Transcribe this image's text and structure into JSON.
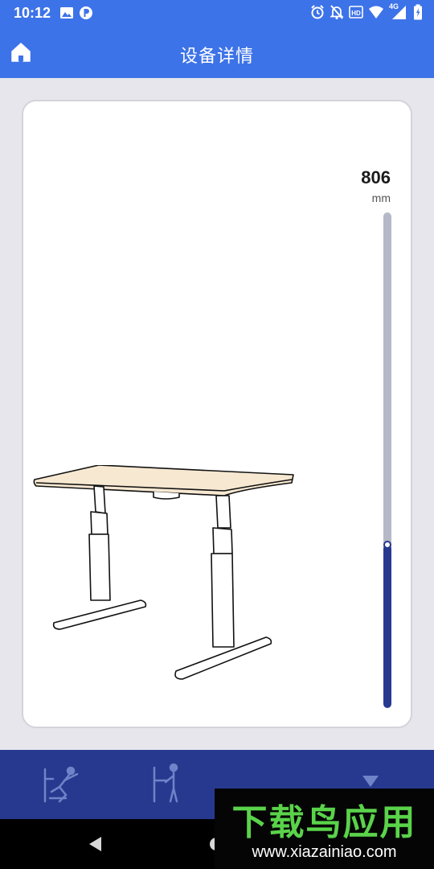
{
  "status_bar": {
    "time": "10:12",
    "left_icons": [
      "image-icon",
      "parking-icon"
    ],
    "right_icons": [
      "alarm-icon",
      "notifications-off-icon",
      "hd-icon",
      "wifi-icon",
      "signal-4g-icon",
      "battery-icon"
    ],
    "network_label": "4G",
    "hd_label": "HD"
  },
  "app_bar": {
    "title": "设备详情",
    "home_icon": "home-icon"
  },
  "device": {
    "height_value": "806",
    "height_unit": "mm",
    "slider_level": 0.33,
    "illustration": "standing-desk"
  },
  "presets": [
    {
      "name": "sitting-preset-icon"
    },
    {
      "name": "standing-preset-icon"
    },
    {
      "name": "raise-arrow-icon"
    },
    {
      "name": "lower-arrow-icon"
    }
  ],
  "watermark": {
    "title": "下载鸟应用",
    "url": "www.xiazainiao.com"
  },
  "colors": {
    "primary": "#3d73e8",
    "panel": "#27398f",
    "background": "#e6e6ec",
    "slider_track": "#b5b8c7",
    "desktop_surface": "#f7e8d2"
  }
}
